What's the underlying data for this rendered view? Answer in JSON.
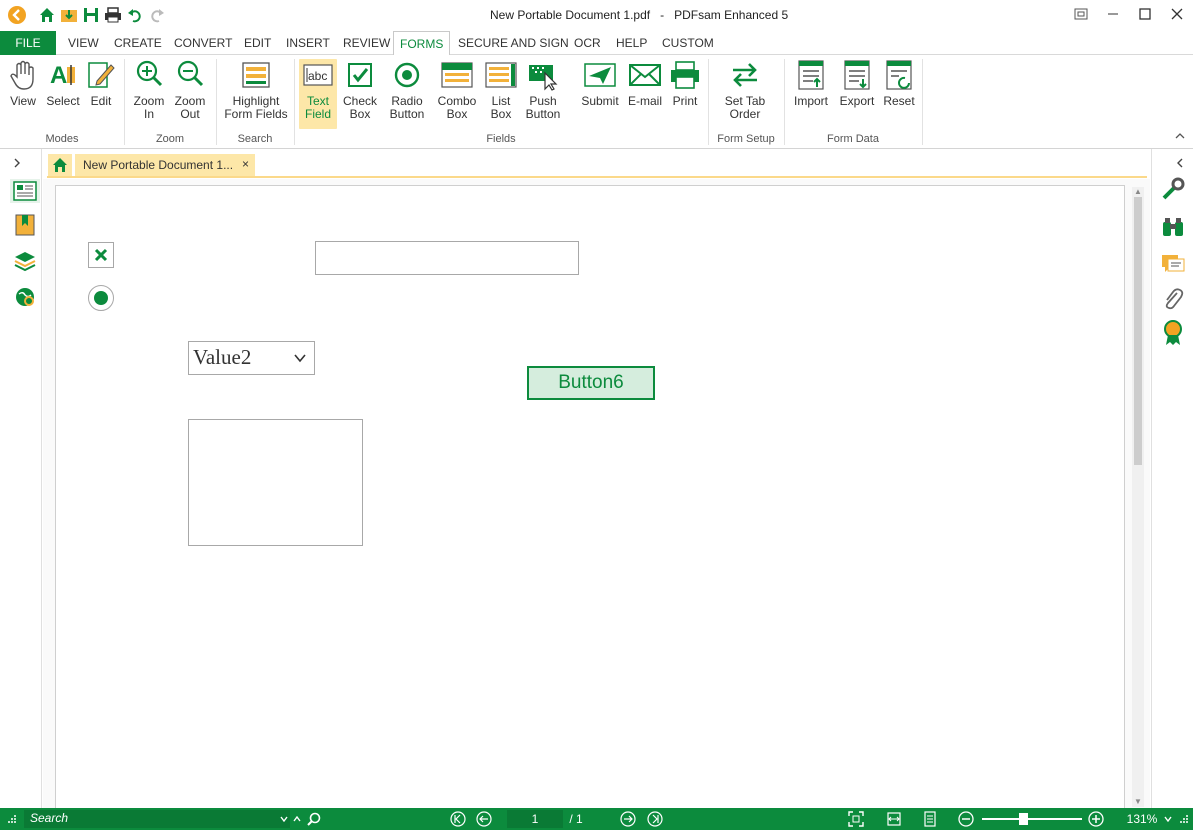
{
  "app": {
    "title": "New Portable Document 1.pdf   -   PDFsam Enhanced 5"
  },
  "menu": {
    "file": "FILE",
    "tabs": [
      "VIEW",
      "CREATE",
      "CONVERT",
      "EDIT",
      "INSERT",
      "REVIEW",
      "FORMS",
      "SECURE AND SIGN",
      "OCR",
      "HELP",
      "CUSTOM"
    ],
    "active_tab": "FORMS"
  },
  "ribbon": {
    "modes": {
      "label": "Modes",
      "view": "View",
      "select": "Select",
      "edit": "Edit"
    },
    "zoom": {
      "label": "Zoom",
      "zoom_in_1": "Zoom",
      "zoom_in_2": "In",
      "zoom_out_1": "Zoom",
      "zoom_out_2": "Out"
    },
    "search": {
      "label": "Search",
      "highlight_1": "Highlight",
      "highlight_2": "Form Fields"
    },
    "fields": {
      "label": "Fields",
      "text_1": "Text",
      "text_2": "Field",
      "check_1": "Check",
      "check_2": "Box",
      "radio_1": "Radio",
      "radio_2": "Button",
      "combo_1": "Combo",
      "combo_2": "Box",
      "list_1": "List",
      "list_2": "Box",
      "push_1": "Push",
      "push_2": "Button",
      "submit": "Submit",
      "email": "E-mail",
      "print": "Print"
    },
    "form_setup": {
      "label": "Form Setup",
      "tab_order_1": "Set Tab",
      "tab_order_2": "Order"
    },
    "form_data": {
      "label": "Form Data",
      "import": "Import",
      "export": "Export",
      "reset": "Reset"
    }
  },
  "document": {
    "tab_title": "New Portable Document 1...",
    "close": "×"
  },
  "form": {
    "combo_value": "Value2",
    "button_label": "Button6"
  },
  "status": {
    "search_placeholder": "Search",
    "page_current": "1",
    "page_total": "/ 1",
    "zoom": "131%"
  },
  "colors": {
    "accent": "#0c8b3d",
    "highlight": "#fde7a8"
  }
}
